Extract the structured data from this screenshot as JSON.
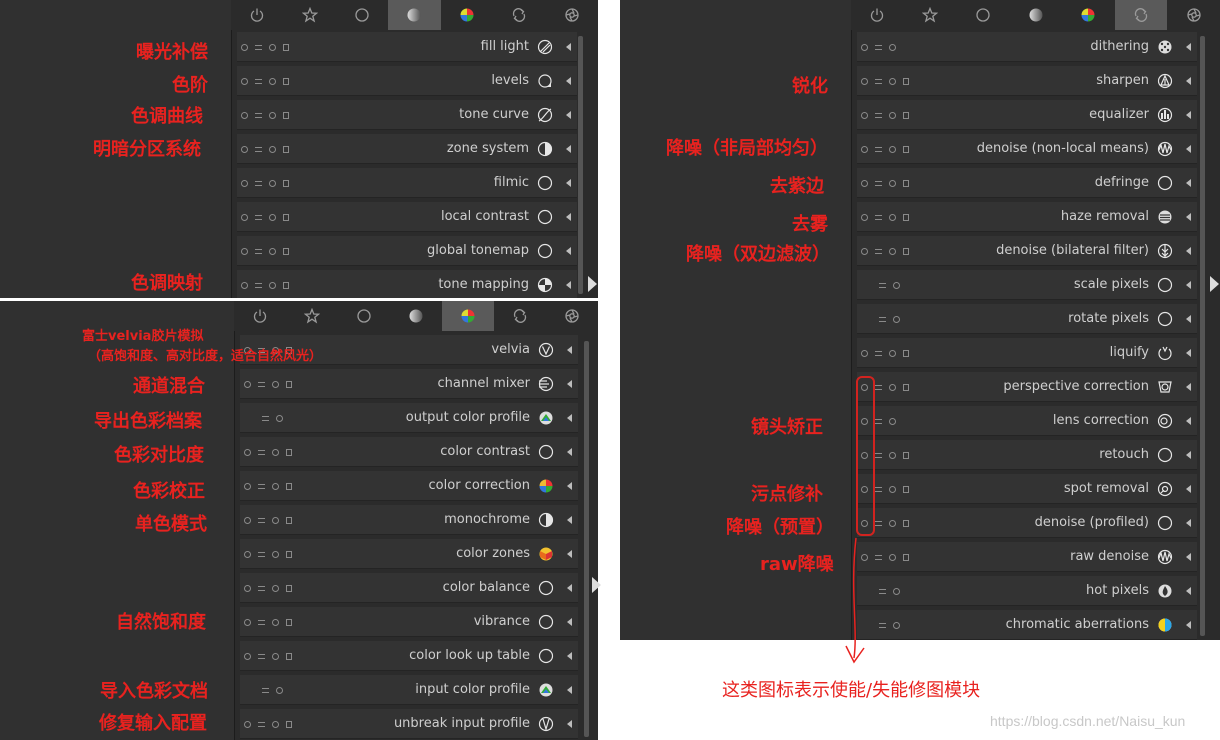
{
  "colors": {
    "annotation": "#e8221f",
    "panel": "#303030",
    "active_tab": "#5a5a5a",
    "module_bg": "#333333"
  },
  "tabs": [
    {
      "name": "power-tab",
      "icon": "power-icon"
    },
    {
      "name": "star-tab",
      "icon": "star-icon"
    },
    {
      "name": "circle-tab",
      "icon": "circle-icon"
    },
    {
      "name": "tone-tab",
      "icon": "half-circle-icon"
    },
    {
      "name": "color-tab",
      "icon": "color-wheel-icon"
    },
    {
      "name": "correct-tab",
      "icon": "arrows-icon"
    },
    {
      "name": "effect-tab",
      "icon": "aperture-icon"
    }
  ],
  "panels": {
    "tone": {
      "modules": [
        {
          "label": "fill light",
          "icon": "wand"
        },
        {
          "label": "levels",
          "icon": "levels"
        },
        {
          "label": "tone curve",
          "icon": "curve"
        },
        {
          "label": "zone system",
          "icon": "half"
        },
        {
          "label": "filmic",
          "icon": "circle"
        },
        {
          "label": "local contrast",
          "icon": "circle"
        },
        {
          "label": "global tonemap",
          "icon": "circle"
        },
        {
          "label": "tone mapping",
          "icon": "quad"
        }
      ],
      "annotations": [
        "曝光补偿",
        "色阶",
        "色调曲线",
        "明暗分区系统",
        "色调映射"
      ]
    },
    "color": {
      "modules": [
        {
          "label": "velvia",
          "icon": "vee"
        },
        {
          "label": "channel mixer",
          "icon": "mixer"
        },
        {
          "label": "output color profile",
          "icon": "profile"
        },
        {
          "label": "color contrast",
          "icon": "circle"
        },
        {
          "label": "color correction",
          "icon": "colorball"
        },
        {
          "label": "monochrome",
          "icon": "half"
        },
        {
          "label": "color zones",
          "icon": "cube"
        },
        {
          "label": "color balance",
          "icon": "circle"
        },
        {
          "label": "vibrance",
          "icon": "circle"
        },
        {
          "label": "color look up table",
          "icon": "circle"
        },
        {
          "label": "input color profile",
          "icon": "profile"
        },
        {
          "label": "unbreak input profile",
          "icon": "unbreak"
        }
      ],
      "annotations": {
        "velvia_line1": "富士velvia胶片模拟",
        "velvia_line2": "（高饱和度、高对比度，适合自然风光）",
        "channel_mixer": "通道混合",
        "output_profile": "导出色彩档案",
        "color_contrast": "色彩对比度",
        "color_correction": "色彩校正",
        "monochrome": "单色模式",
        "vibrance": "自然饱和度",
        "input_profile": "导入色彩文档",
        "unbreak": "修复输入配置"
      }
    },
    "correct": {
      "modules": [
        {
          "label": "dithering",
          "icon": "dots"
        },
        {
          "label": "sharpen",
          "icon": "sharpen"
        },
        {
          "label": "equalizer",
          "icon": "equalizer"
        },
        {
          "label": "denoise (non-local means)",
          "icon": "noise"
        },
        {
          "label": "defringe",
          "icon": "circle"
        },
        {
          "label": "haze removal",
          "icon": "haze"
        },
        {
          "label": "denoise (bilateral filter)",
          "icon": "bilateral"
        },
        {
          "label": "scale pixels",
          "icon": "circle"
        },
        {
          "label": "rotate pixels",
          "icon": "circle"
        },
        {
          "label": "liquify",
          "icon": "liquify"
        },
        {
          "label": "perspective correction",
          "icon": "persp"
        },
        {
          "label": "lens correction",
          "icon": "lens"
        },
        {
          "label": "retouch",
          "icon": "circle"
        },
        {
          "label": "spot removal",
          "icon": "spot"
        },
        {
          "label": "denoise (profiled)",
          "icon": "circle"
        },
        {
          "label": "raw denoise",
          "icon": "noise"
        },
        {
          "label": "hot pixels",
          "icon": "hot"
        },
        {
          "label": "chromatic aberrations",
          "icon": "chroma"
        }
      ],
      "annotations": {
        "sharpen": "锐化",
        "denoise_nlm": "降噪（非局部均匀）",
        "defringe": "去紫边",
        "haze": "去雾",
        "denoise_bilateral": "降噪（双边滤波）",
        "lens": "镜头矫正",
        "spot": "污点修补",
        "denoise_profiled": "降噪（预置）",
        "raw_denoise": "raw降噪"
      }
    }
  },
  "footnote": "这类图标表示使能/失能修图模块",
  "watermark": "https://blog.csdn.net/Naisu_kun"
}
